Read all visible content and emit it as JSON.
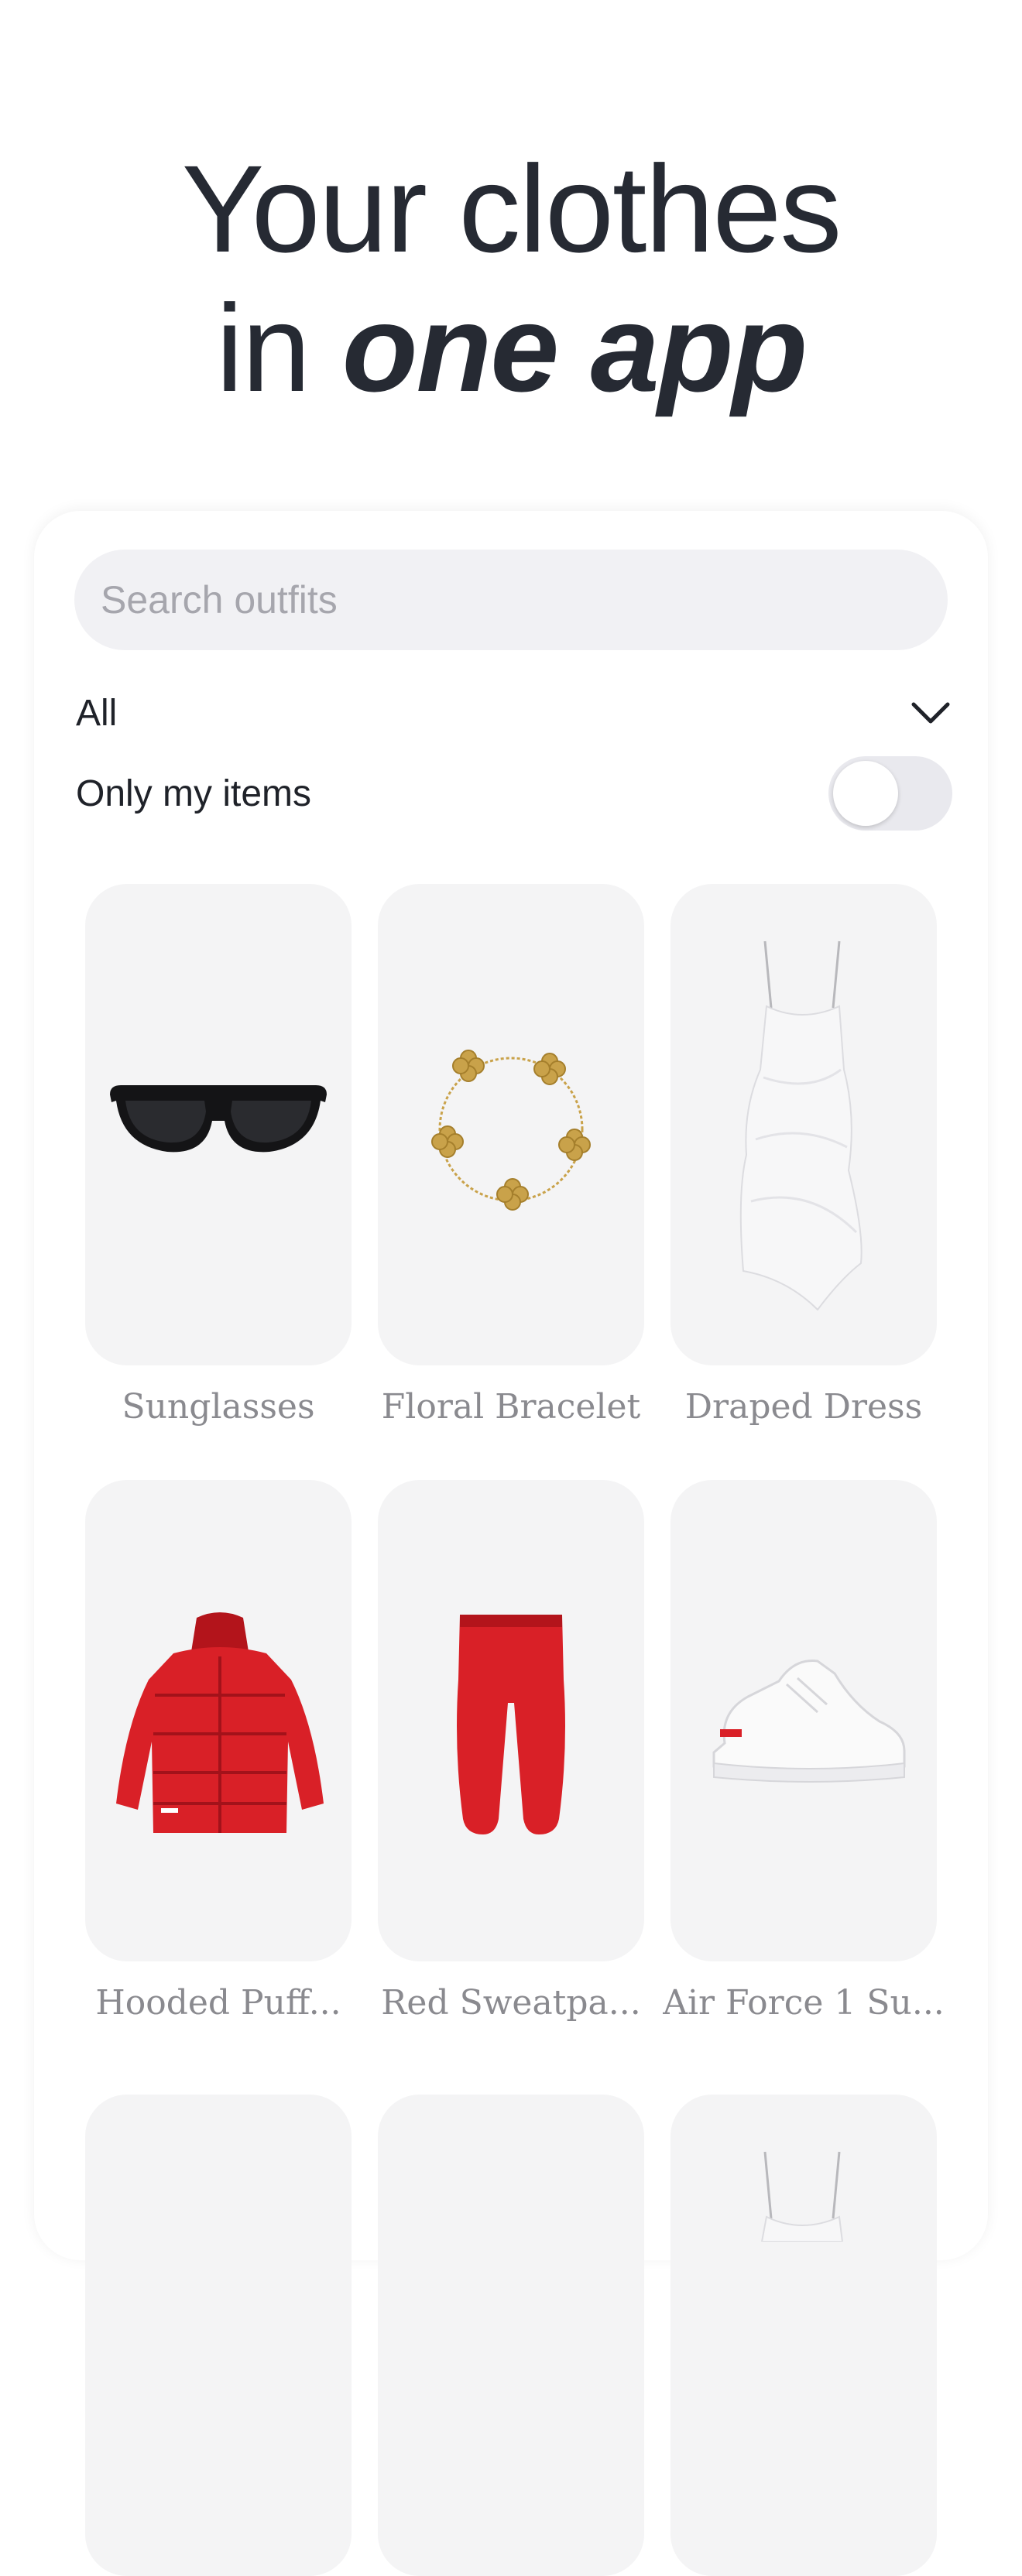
{
  "headline": {
    "line1": "Your clothes",
    "line2_prefix": "in ",
    "line2_emphasis": "one app"
  },
  "search": {
    "placeholder": "Search outfits"
  },
  "filters": {
    "category_label": "All",
    "only_mine_label": "Only my items",
    "only_mine_enabled": false
  },
  "items": [
    {
      "name": "Sunglasses",
      "icon": "sunglasses"
    },
    {
      "name": "Floral Bracelet",
      "icon": "bracelet"
    },
    {
      "name": "Draped Dress",
      "icon": "dress"
    },
    {
      "name": "Hooded Puff...",
      "icon": "puffer-jacket"
    },
    {
      "name": "Red Sweatpa...",
      "icon": "sweatpants"
    },
    {
      "name": "Air Force 1 Su...",
      "icon": "sneaker"
    }
  ],
  "colors": {
    "text_dark": "#262a33",
    "card_bg": "#f4f4f5",
    "search_bg": "#f1f1f4",
    "accent_red": "#d92027",
    "gold": "#c9a24a"
  }
}
